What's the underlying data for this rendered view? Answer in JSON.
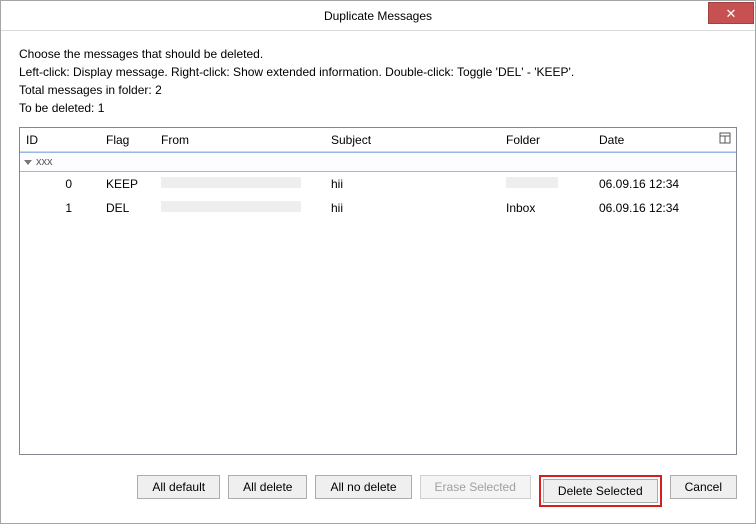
{
  "window": {
    "title": "Duplicate Messages"
  },
  "instructions": {
    "line1": "Choose the messages that should be deleted.",
    "line2": "Left-click: Display message. Right-click: Show extended information. Double-click: Toggle 'DEL' - 'KEEP'.",
    "total": "Total messages in folder: 2",
    "tobedel": "To be deleted: 1"
  },
  "columns": {
    "id": "ID",
    "flag": "Flag",
    "from": "From",
    "subject": "Subject",
    "folder": "Folder",
    "date": "Date"
  },
  "group": {
    "label": "xxx"
  },
  "rows": [
    {
      "id": "0",
      "flag": "KEEP",
      "from": "",
      "subject": "hii",
      "folder": "",
      "date": "06.09.16 12:34"
    },
    {
      "id": "1",
      "flag": "DEL",
      "from": "",
      "subject": "hii",
      "folder": "Inbox",
      "date": "06.09.16 12:34"
    }
  ],
  "buttons": {
    "all_default": "All default",
    "all_delete": "All delete",
    "all_no_delete": "All no delete",
    "erase_selected": "Erase Selected",
    "delete_selected": "Delete Selected",
    "cancel": "Cancel"
  }
}
